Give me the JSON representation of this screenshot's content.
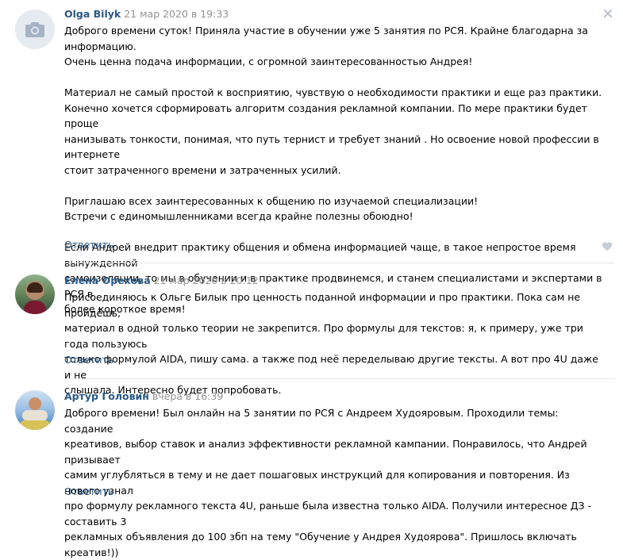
{
  "comments": [
    {
      "author": "Olga Bilyk",
      "date": "21 мар 2020 в 19:33",
      "text": "Доброго времени суток! Приняла участие в обучении уже 5 занятия по РСЯ. Крайне благодарна за информацию.\nОчень ценна подача информации, с огромной заинтересованностью Андрея!\n\nМатериал не самый простой к восприятию, чувствую о необходимости практики и еще раз практики.\nКонечно хочется сформировать алгоритм создания рекламной компании. По мере практики будет проще\nнанизывать тонкости, понимая, что путь тернист и требует знаний . Но освоение новой профессии в интернете\nстоит затраченного времени и затраченных усилий.\n\nПриглашаю всех заинтересованных к общению по изучаемой специализации!\nВстречи с единомышленниками всегда крайне полезны обоюдно!\n\nЕсли Андрей внедрит практику общения и обмена информацией чаще, в такое непростое время вынужденной\nсамоизоляции, то мы в обучении и в практике продвинемся, и станем специалистами и экспертами в РСЯ в\nболее короткое время!",
      "reply_label": "Ответить",
      "avatar_icon": "camera-icon"
    },
    {
      "author": "Елена Орехова",
      "date": "21 мар 2020 в 20:12",
      "text": "Присоединяюсь к Ольге Билык про ценность поданной информации и про практики. Пока сам не пройдёшь,\nматериал в одной только теории не закрепится. Про формулы для текстов: я, к примеру, уже три года пользуюсь\nтолько формулой AIDA, пишу сама. а также под неё переделываю другие тексты. А вот про 4U даже и не\nслышала. Интересно будет попробовать.",
      "reply_label": "Ответить"
    },
    {
      "author": "Артур Головин",
      "date": "вчера в 16:39",
      "text": "Доброго времени! Был онлайн на 5 занятии по РСЯ с Андреем Худояровым. Проходили темы: создание\nкреативов, выбор ставок и анализ эффективности рекламной кампании. Понравилось, что Андрей призывает\nсамим углубляться в тему и не дает пошаговых инструкций для копирования и повторения. Из нового узнал\nпро формулу рекламного текста 4U, раньше была известна только AIDA. Получили интересное ДЗ - составить 3\nрекламных объявления до 100 збп на тему \"Обучение у Андрея Худоярова\". Пришлось включать креатив!))",
      "reply_label": "Ответить"
    }
  ],
  "icons": {
    "close": "close-icon",
    "like": "heart-icon"
  },
  "colors": {
    "link": "#2a5885",
    "meta": "#939393",
    "divider": "#e7e8ec",
    "avatar_placeholder": "#e5ebf1"
  }
}
